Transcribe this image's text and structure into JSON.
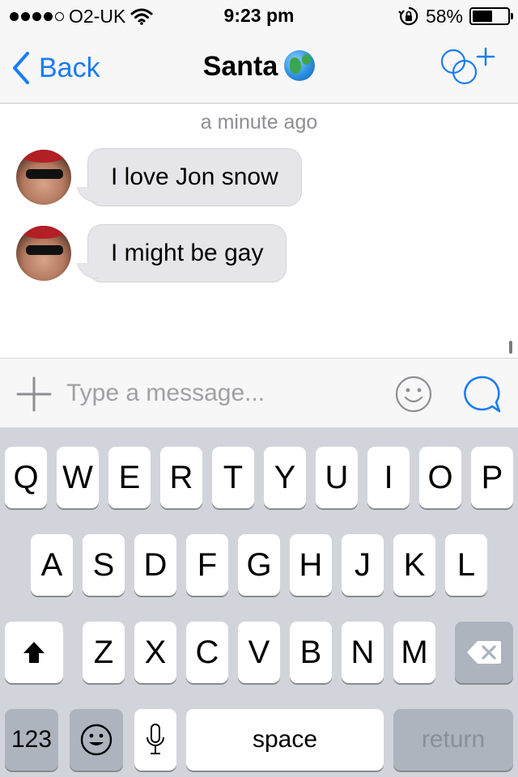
{
  "status_bar": {
    "carrier": "O2-UK",
    "time": "9:23 pm",
    "battery_percent": "58%",
    "battery_level": 0.58,
    "signal_bars": 4,
    "signal_max": 5,
    "icons": [
      "signal-dots-icon",
      "wifi-icon",
      "orientation-lock-icon",
      "battery-icon"
    ]
  },
  "nav": {
    "back_label": "Back",
    "title": "Santa",
    "title_emoji": "globe-icon",
    "action": "add-people-icon",
    "accent_color": "#1a7cf5"
  },
  "chat": {
    "timestamp": "a minute ago",
    "messages": [
      {
        "text": "I love Jon snow",
        "sender": "contact"
      },
      {
        "text": "I might be gay",
        "sender": "contact"
      }
    ]
  },
  "composer": {
    "placeholder": "Type a message...",
    "value": "",
    "icons": [
      "plus-icon",
      "smiley-icon",
      "send-bubble-icon"
    ]
  },
  "keyboard": {
    "row1": [
      "Q",
      "W",
      "E",
      "R",
      "T",
      "Y",
      "U",
      "I",
      "O",
      "P"
    ],
    "row2": [
      "A",
      "S",
      "D",
      "F",
      "G",
      "H",
      "J",
      "K",
      "L"
    ],
    "row3": [
      "Z",
      "X",
      "C",
      "V",
      "B",
      "N",
      "M"
    ],
    "numbers_label": "123",
    "space_label": "space",
    "return_label": "return",
    "icons": [
      "shift-icon",
      "backspace-icon",
      "emoji-keyboard-icon",
      "microphone-icon"
    ]
  }
}
